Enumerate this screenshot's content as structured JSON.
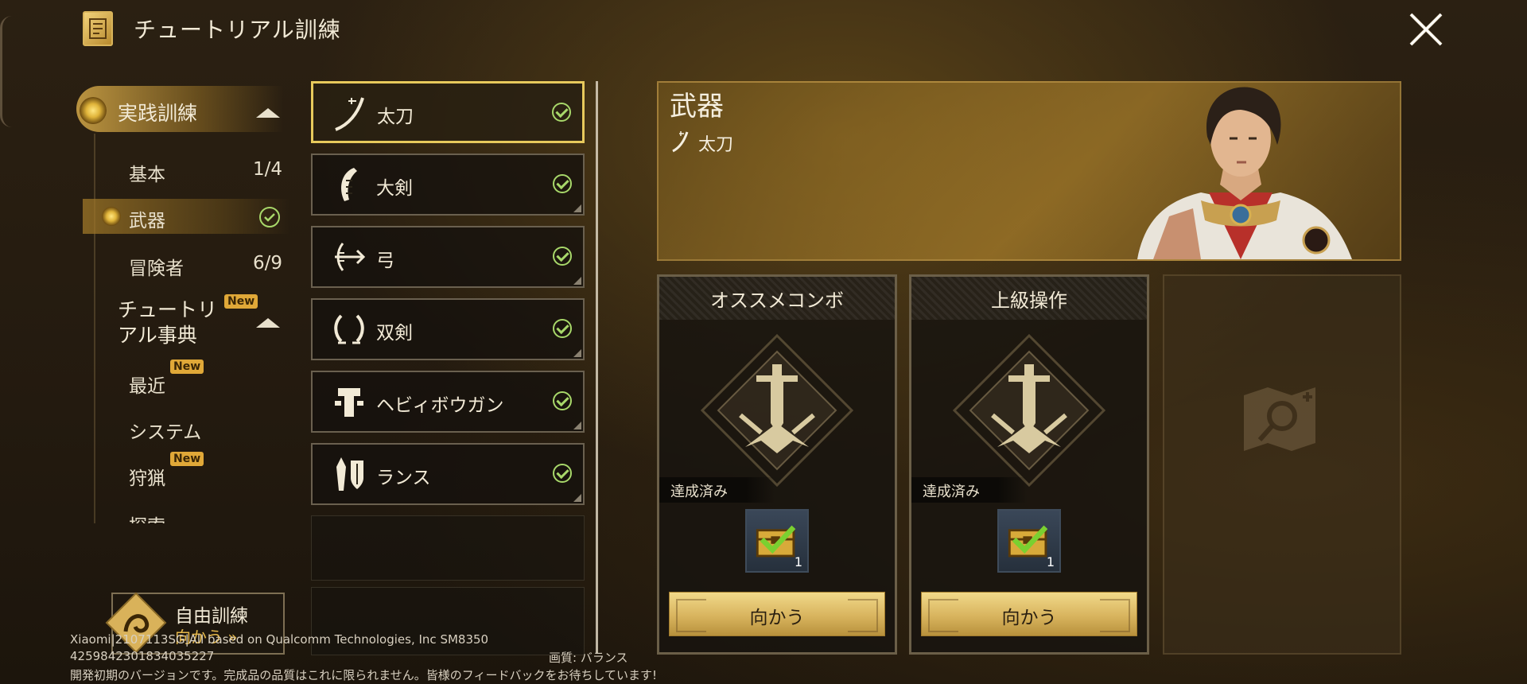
{
  "header": {
    "title": "チュートリアル訓練"
  },
  "sidebar": {
    "practice": {
      "label": "実践訓練"
    },
    "items": [
      {
        "label": "基本",
        "progress": "1/4"
      },
      {
        "label": "武器"
      },
      {
        "label": "冒険者",
        "progress": "6/9"
      }
    ],
    "encyclopedia": {
      "label_line1": "チュートリ",
      "label_line2": "アル事典",
      "badge": "New"
    },
    "encyclopedia_items": [
      {
        "label": "最近",
        "badge": "New"
      },
      {
        "label": "システム"
      },
      {
        "label": "狩猟",
        "badge": "New"
      },
      {
        "label": "探索"
      }
    ],
    "free_training": {
      "title": "自由訓練",
      "subtitle": "向かう »"
    }
  },
  "weapons": [
    {
      "name": "太刀",
      "completed": true,
      "icon": "long-sword-icon"
    },
    {
      "name": "大剣",
      "completed": true,
      "icon": "great-sword-icon"
    },
    {
      "name": "弓",
      "completed": true,
      "icon": "bow-icon"
    },
    {
      "name": "双剣",
      "completed": true,
      "icon": "dual-blades-icon"
    },
    {
      "name": "ヘビィボウガン",
      "completed": true,
      "icon": "heavy-bowgun-icon"
    },
    {
      "name": "ランス",
      "completed": true,
      "icon": "lance-icon"
    }
  ],
  "detail": {
    "title": "武器",
    "weapon_name": "太刀",
    "cards": [
      {
        "title": "オススメコンボ",
        "status": "達成済み",
        "reward_count": "1",
        "button": "向かう"
      },
      {
        "title": "上級操作",
        "status": "達成済み",
        "reward_count": "1",
        "button": "向かう"
      }
    ]
  },
  "footer": {
    "device_line": "Xiaomi|2107113SG|All based on Qualcomm Technologies, Inc SM8350",
    "build_id": "4259842301834035227",
    "quality": "画質: バランス",
    "notice": "開発初期のバージョンです。完成品の品質はこれに限られません。皆様のフィードバックをお待ちしています!"
  },
  "colors": {
    "accent": "#e7c95c",
    "check": "#a8d86a",
    "button": "#d8b45e",
    "new_badge": "#e0a838"
  }
}
